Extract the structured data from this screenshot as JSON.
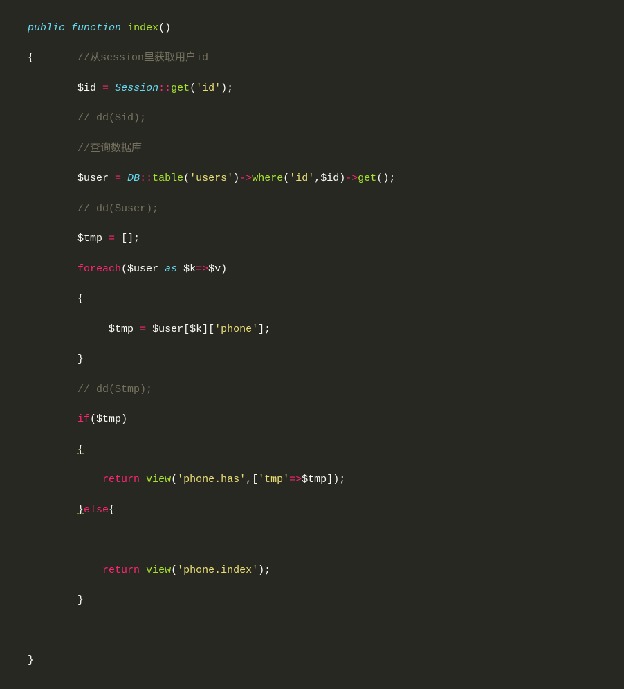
{
  "code": {
    "l1_public": "public",
    "l1_function": "function",
    "l1_name": "index",
    "l1_paren": "()",
    "l2_brace": "{",
    "l2_comment": "//从session里获取用户id",
    "l3_var": "$id",
    "l3_eq": "=",
    "l3_class": "Session",
    "l3_dc": "::",
    "l3_fn": "get",
    "l3_open": "(",
    "l3_str": "'id'",
    "l3_close": ");",
    "l4_comment": "// dd($id);",
    "l5_comment": "//查询数据库",
    "l6_var": "$user",
    "l6_eq": "=",
    "l6_class": "DB",
    "l6_dc": "::",
    "l6_fn1": "table",
    "l6_open1": "(",
    "l6_str1": "'users'",
    "l6_close1": ")",
    "l6_arr1": "->",
    "l6_fn2": "where",
    "l6_open2": "(",
    "l6_str2": "'id'",
    "l6_comma": ",",
    "l6_var2": "$id",
    "l6_close2": ")",
    "l6_arr2": "->",
    "l6_fn3": "get",
    "l6_close3": "();",
    "l7_comment": "// dd($user);",
    "l8_var": "$tmp",
    "l8_eq": "=",
    "l8_arr": "[];",
    "l9_foreach": "foreach",
    "l9_open": "(",
    "l9_var1": "$user",
    "l9_as": "as",
    "l9_var2": "$k",
    "l9_fat": "=>",
    "l9_var3": "$v",
    "l9_close": ")",
    "l10_brace": "{",
    "l11_var1": "$tmp",
    "l11_eq": "=",
    "l11_var2": "$user",
    "l11_open": "[",
    "l11_var3": "$k",
    "l11_close": "][",
    "l11_str": "'phone'",
    "l11_end": "];",
    "l12_brace": "}",
    "l13_comment": "// dd($tmp);",
    "l14_if": "if",
    "l14_open": "(",
    "l14_var": "$tmp",
    "l14_close": ")",
    "l15_brace": "{",
    "l16_return": "return",
    "l16_fn": "view",
    "l16_open": "(",
    "l16_str1": "'phone.has'",
    "l16_comma": ",[",
    "l16_str2": "'tmp'",
    "l16_fat": "=>",
    "l16_var": "$tmp",
    "l16_close": "]);",
    "l17_brace": "}",
    "l17_else": "else",
    "l17_brace2": "{",
    "l19_return": "return",
    "l19_fn": "view",
    "l19_open": "(",
    "l19_str": "'phone.index'",
    "l19_close": ");",
    "l20_brace": "}",
    "l22_brace": "}"
  }
}
